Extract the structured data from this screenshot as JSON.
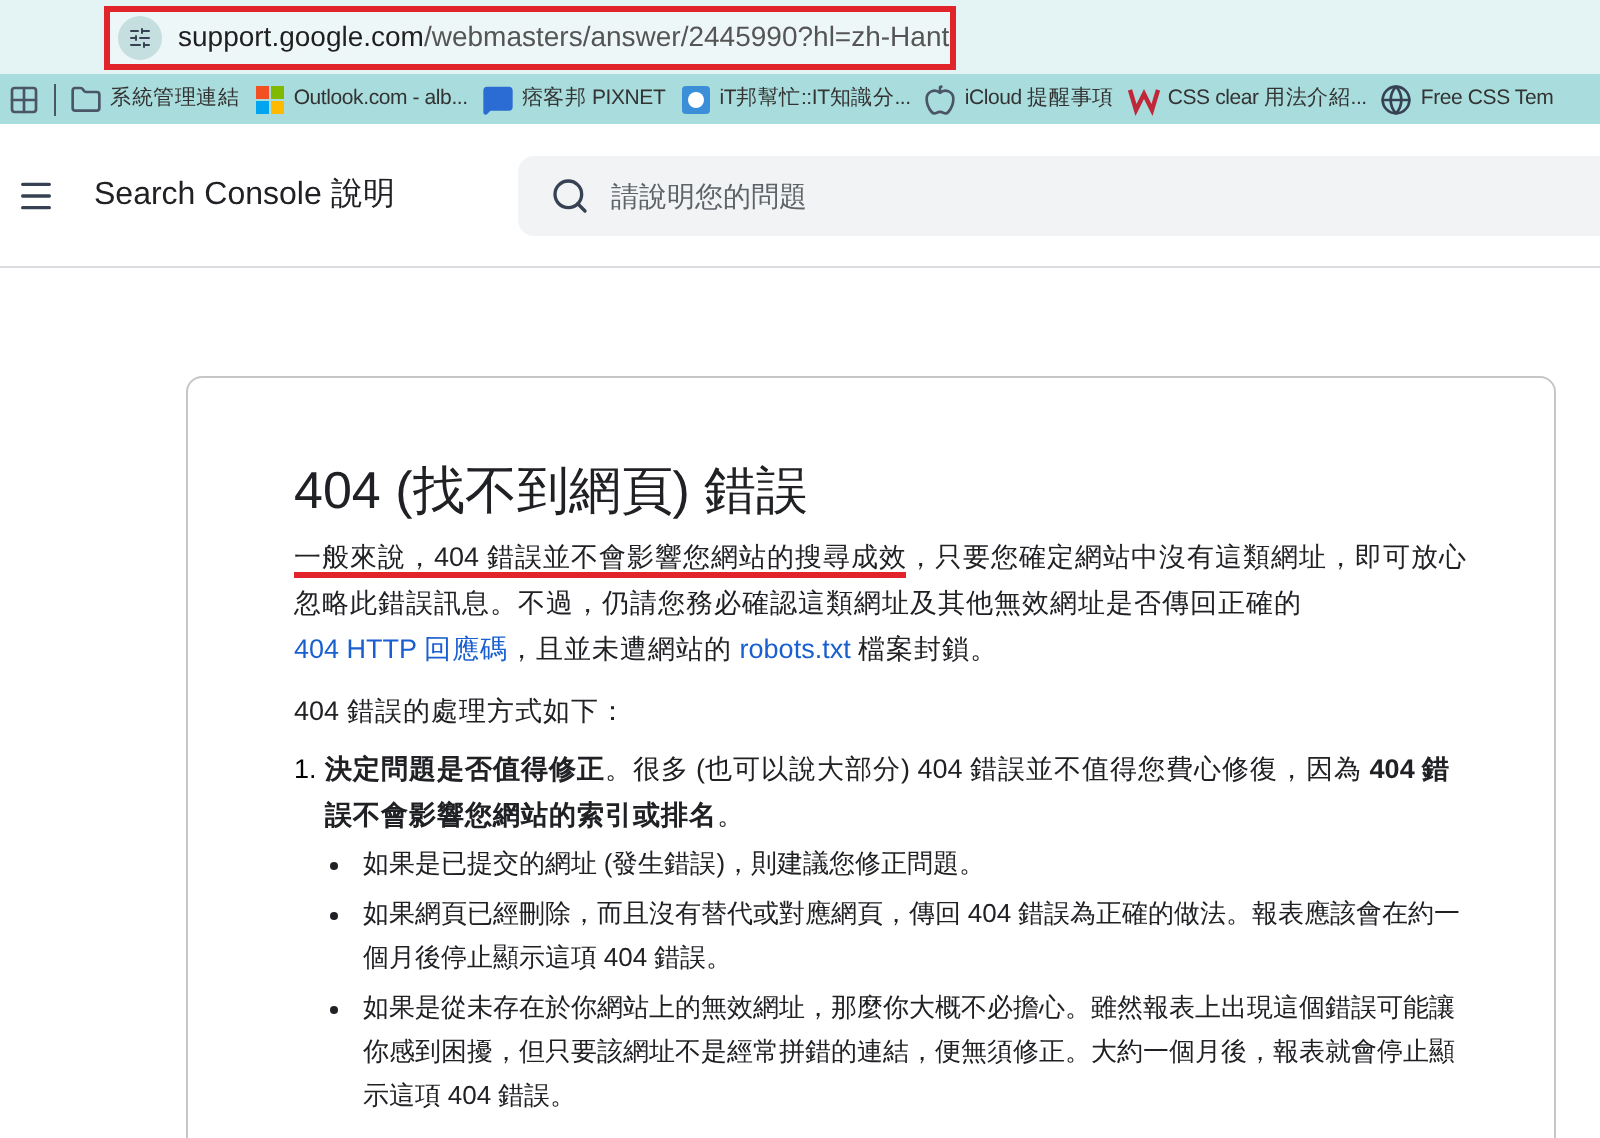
{
  "browser": {
    "url_host": "support.google.com",
    "url_path": "/webmasters/answer/2445990?hl=zh-Hant",
    "url_highlighted": true,
    "bookmarks": [
      {
        "kind": "folder",
        "label": "系統管理連結"
      },
      {
        "kind": "tiles",
        "label": "Outlook.com - alb..."
      },
      {
        "kind": "bubble",
        "label": "痞客邦 PIXNET"
      },
      {
        "kind": "square",
        "label": "iT邦幫忙::IT知識分..."
      },
      {
        "kind": "apple",
        "label": "iCloud 提醒事項"
      },
      {
        "kind": "w",
        "label": "CSS clear 用法介紹..."
      },
      {
        "kind": "globe",
        "label": "Free CSS Tem"
      }
    ]
  },
  "header": {
    "title": "Search Console 說明",
    "search": {
      "placeholder": "請說明您的問題"
    }
  },
  "article": {
    "title": "404 (找不到網頁) 錯誤",
    "intro": [
      {
        "kind": "underlined",
        "text": "一般來說，404 錯誤並不會影響您網站的搜尋成效"
      },
      {
        "kind": "text",
        "text": "，只要您確定網站中沒有這類網址，即可放心忽略此錯誤訊息。不過，仍請您務必確認這類網址及其他無效網址是否傳回正確的 "
      },
      {
        "kind": "link",
        "text": "404 HTTP 回應碼"
      },
      {
        "kind": "text",
        "text": "，且並未遭網站的 "
      },
      {
        "kind": "link",
        "text": "robots.txt"
      },
      {
        "kind": "text",
        "text": " 檔案封鎖。"
      }
    ],
    "lead": "404 錯誤的處理方式如下：",
    "steps": [
      {
        "number": "1.",
        "text": "**決定問題是否值得修正**。很多 (也可以說大部分) 404 錯誤並不值得您費心修復，因為 **404 錯誤不會影響您網站的索引或排名**。",
        "bullets": [
          "如果是已提交的網址 (發生錯誤)，則建議您修正問題。",
          "如果網頁已經刪除，而且沒有替代或對應網頁，傳回 404 錯誤為正確的做法。報表應該會在約一個月後停止顯示這項 404 錯誤。",
          "如果是從未存在於你網站上的無效網址，那麼你大概不必擔心。雖然報表上出現這個錯誤可能讓你感到困擾，但只要該網址不是經常拼錯的連結，便無須修正。大約一個月後，報表就會停止顯示這項 404 錯誤。"
        ]
      }
    ]
  }
}
